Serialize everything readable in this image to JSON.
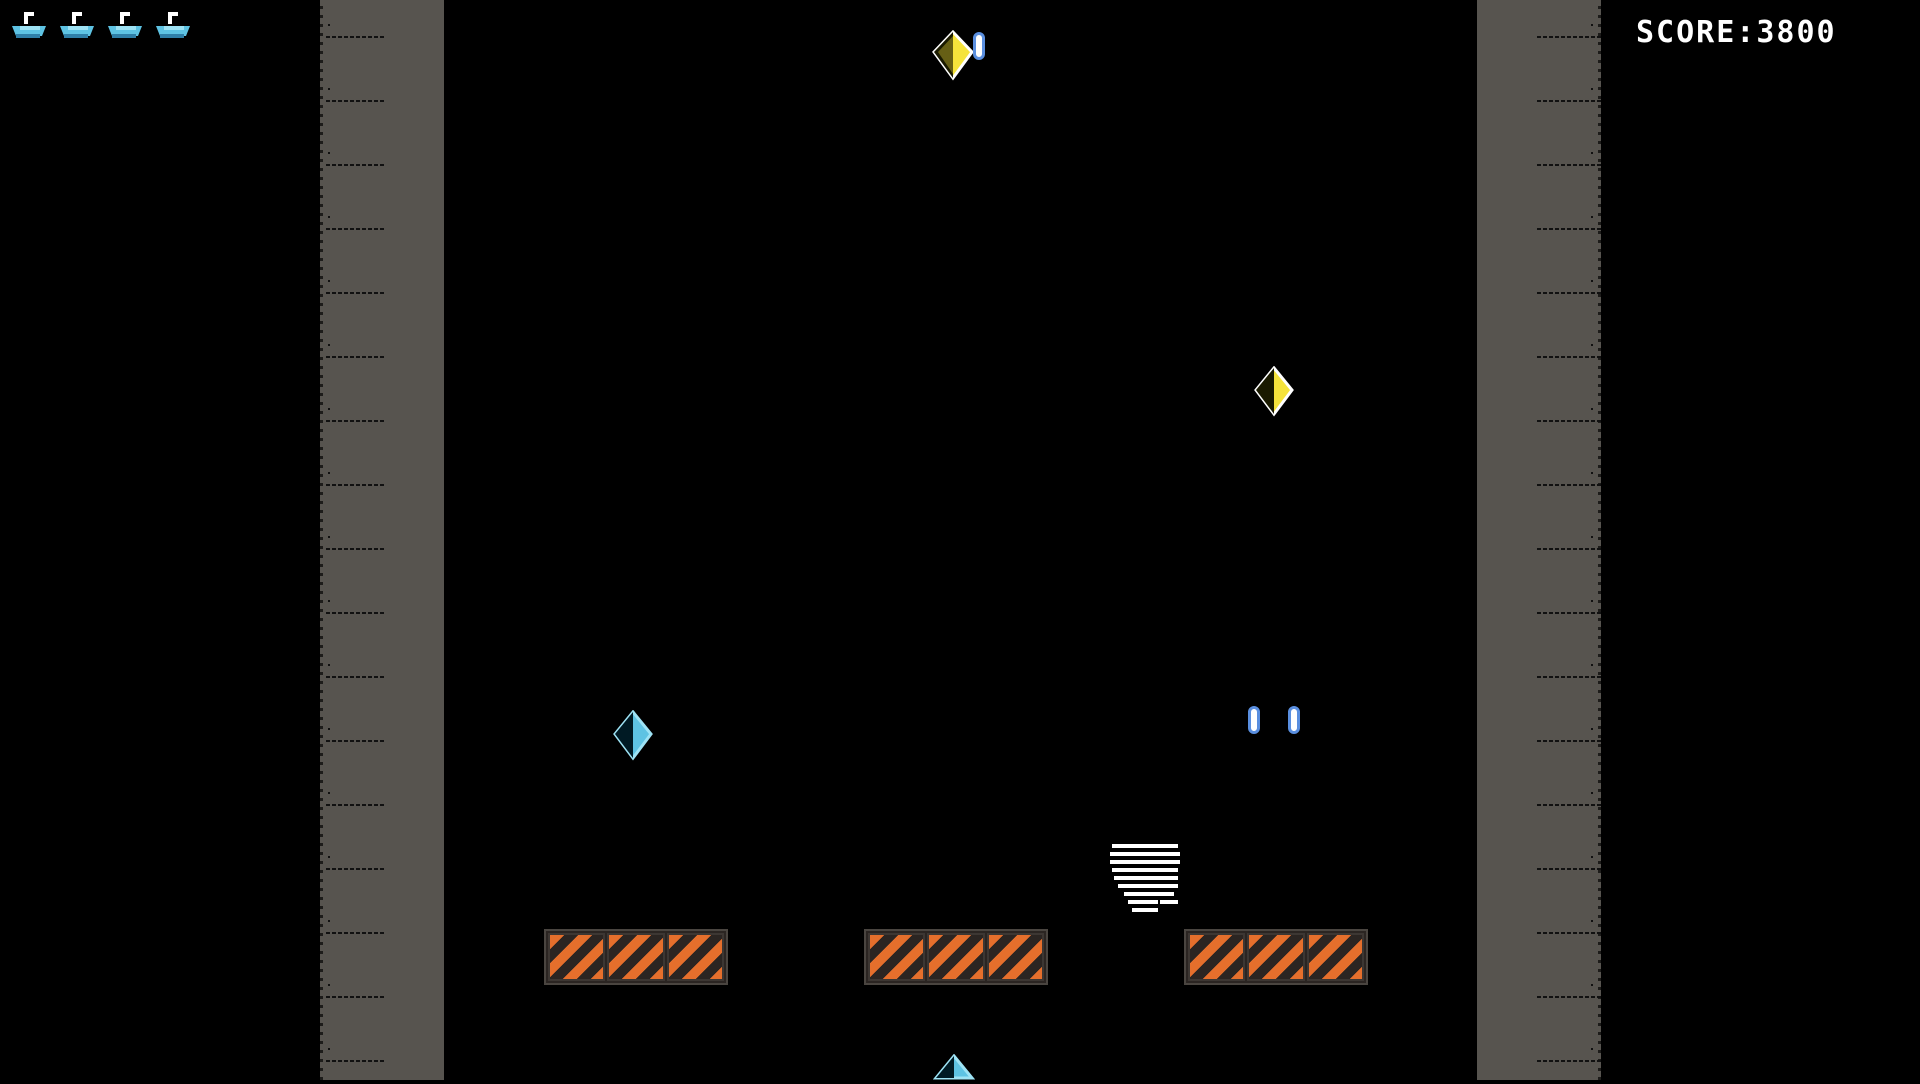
{
  "hud": {
    "score_label": "SCORE:",
    "score_value": "3800",
    "lives_remaining": 4
  },
  "colors": {
    "background": "#000000",
    "wall": "#57544f",
    "hazard_orange": "#e56f2c",
    "gem_yellow": "#f5e33b",
    "gem_cyan": "#5ec3e3",
    "ship_cyan": "#5ec3e3",
    "bullet_blue": "#5a8fe0",
    "score_text": "#ffffff"
  },
  "icons": {
    "life": "ship-icon",
    "gem": "diamond-gem-icon",
    "player": "striped-player-ship-icon",
    "bullet": "capsule-bullet-icon",
    "barrier": "hazard-barrier-icon"
  }
}
